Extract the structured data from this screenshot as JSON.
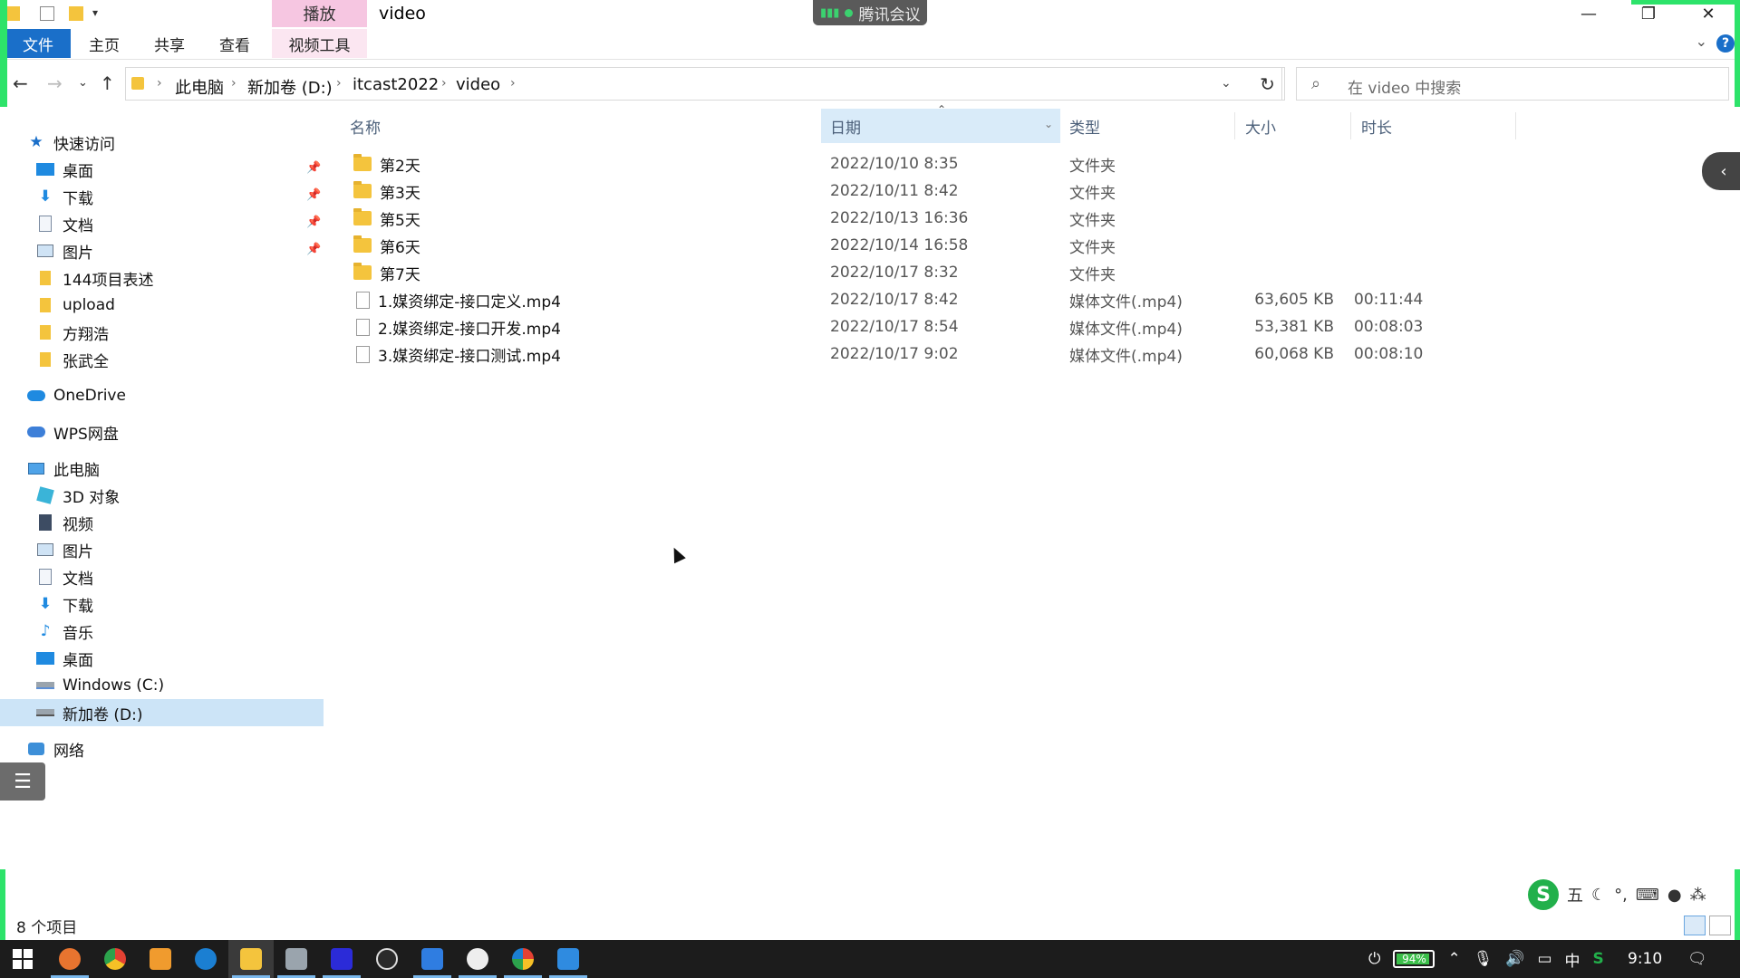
{
  "window": {
    "title": "video",
    "contextual_tab_header": "播放",
    "meeting_indicator": "腾讯会议"
  },
  "ribbon": {
    "tabs": [
      "文件",
      "主页",
      "共享",
      "查看",
      "视频工具"
    ]
  },
  "address": {
    "crumbs": [
      "此电脑",
      "新加卷 (D:)",
      "itcast2022",
      "video"
    ],
    "search_placeholder": "在 video 中搜索"
  },
  "nav": {
    "quick_access": "快速访问",
    "pinned": [
      "桌面",
      "下载",
      "文档",
      "图片"
    ],
    "recent": [
      "144项目表述",
      "upload",
      "方翔浩",
      "张武全"
    ],
    "onedrive": "OneDrive",
    "wps": "WPS网盘",
    "this_pc": "此电脑",
    "pc_items": [
      "3D 对象",
      "视频",
      "图片",
      "文档",
      "下载",
      "音乐",
      "桌面",
      "Windows (C:)",
      "新加卷 (D:)"
    ],
    "network": "网络",
    "selected_item": "新加卷 (D:)"
  },
  "columns": {
    "name": "名称",
    "date": "日期",
    "type": "类型",
    "size": "大小",
    "duration": "时长",
    "sorted_by": "日期"
  },
  "files": [
    {
      "name": "第2天",
      "date": "2022/10/10 8:35",
      "type": "文件夹",
      "size": "",
      "duration": "",
      "kind": "folder"
    },
    {
      "name": "第3天",
      "date": "2022/10/11 8:42",
      "type": "文件夹",
      "size": "",
      "duration": "",
      "kind": "folder"
    },
    {
      "name": "第5天",
      "date": "2022/10/13 16:36",
      "type": "文件夹",
      "size": "",
      "duration": "",
      "kind": "folder"
    },
    {
      "name": "第6天",
      "date": "2022/10/14 16:58",
      "type": "文件夹",
      "size": "",
      "duration": "",
      "kind": "folder"
    },
    {
      "name": "第7天",
      "date": "2022/10/17 8:32",
      "type": "文件夹",
      "size": "",
      "duration": "",
      "kind": "folder"
    },
    {
      "name": "1.媒资绑定-接口定义.mp4",
      "date": "2022/10/17 8:42",
      "type": "媒体文件(.mp4)",
      "size": "63,605 KB",
      "duration": "00:11:44",
      "kind": "file"
    },
    {
      "name": "2.媒资绑定-接口开发.mp4",
      "date": "2022/10/17 8:54",
      "type": "媒体文件(.mp4)",
      "size": "53,381 KB",
      "duration": "00:08:03",
      "kind": "file"
    },
    {
      "name": "3.媒资绑定-接口测试.mp4",
      "date": "2022/10/17 9:02",
      "type": "媒体文件(.mp4)",
      "size": "60,068 KB",
      "duration": "00:08:10",
      "kind": "file"
    }
  ],
  "status": {
    "item_count": "8 个项目"
  },
  "ime": {
    "logo": "S",
    "mode": "五"
  },
  "taskbar": {
    "battery": "94%",
    "ime_lang": "中",
    "clock": "9:10"
  },
  "colors": {
    "accent": "#1a6fc9",
    "context_tab": "#f6c6e1",
    "selection": "#cce4f7",
    "folder": "#f4c43d"
  }
}
